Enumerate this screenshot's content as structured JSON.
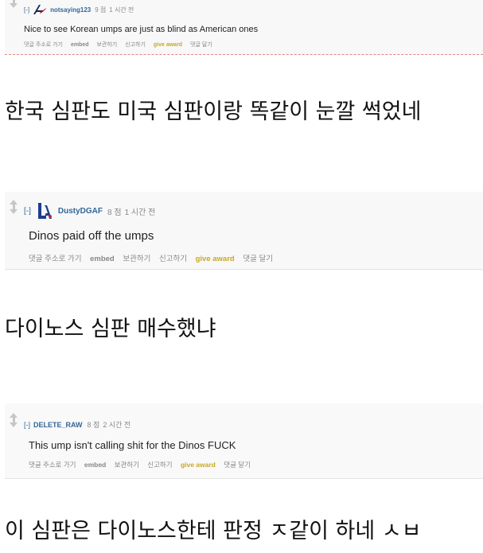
{
  "comments": [
    {
      "collapse": "[-]",
      "author": "notsaying123",
      "score": "9 점",
      "time": "1 시간 전",
      "body": "Nice to see Korean umps are just as blind as American ones",
      "actions": {
        "permalink": "댓글 주소로 가기",
        "embed": "embed",
        "save": "보관하기",
        "report": "신고하기",
        "give_award": "give award",
        "reply": "댓글 달기"
      },
      "flair_icon": "braves-logo-icon"
    },
    {
      "collapse": "[-]",
      "author": "DustyDGAF",
      "score": "8 점",
      "time": "1 시간 전",
      "body": "Dinos paid off the umps",
      "actions": {
        "permalink": "댓글 주소로 가기",
        "embed": "embed",
        "save": "보관하기",
        "report": "신고하기",
        "give_award": "give award",
        "reply": "댓글 달기"
      },
      "flair_icon": "dodgers-logo-icon"
    },
    {
      "collapse": "[-]",
      "author": "DELETE_RAW",
      "score": "8 점",
      "time": "2 시간 전",
      "body": "This ump isn't calling shit for the Dinos FUCK",
      "actions": {
        "permalink": "댓글 주소로 가기",
        "embed": "embed",
        "save": "보관하기",
        "report": "신고하기",
        "give_award": "give award",
        "reply": "댓글 달기"
      }
    }
  ],
  "translations": [
    "한국 심판도 미국 심판이랑 똑같이 눈깔 썩었네",
    "다이노스 심판 매수했냐",
    "이 심판은 다이노스한테 판정 ㅈ같이 하네 ㅅㅂ"
  ],
  "colors": {
    "author": "#336699",
    "give_award": "#c8a826",
    "meta_gray": "#888888"
  }
}
